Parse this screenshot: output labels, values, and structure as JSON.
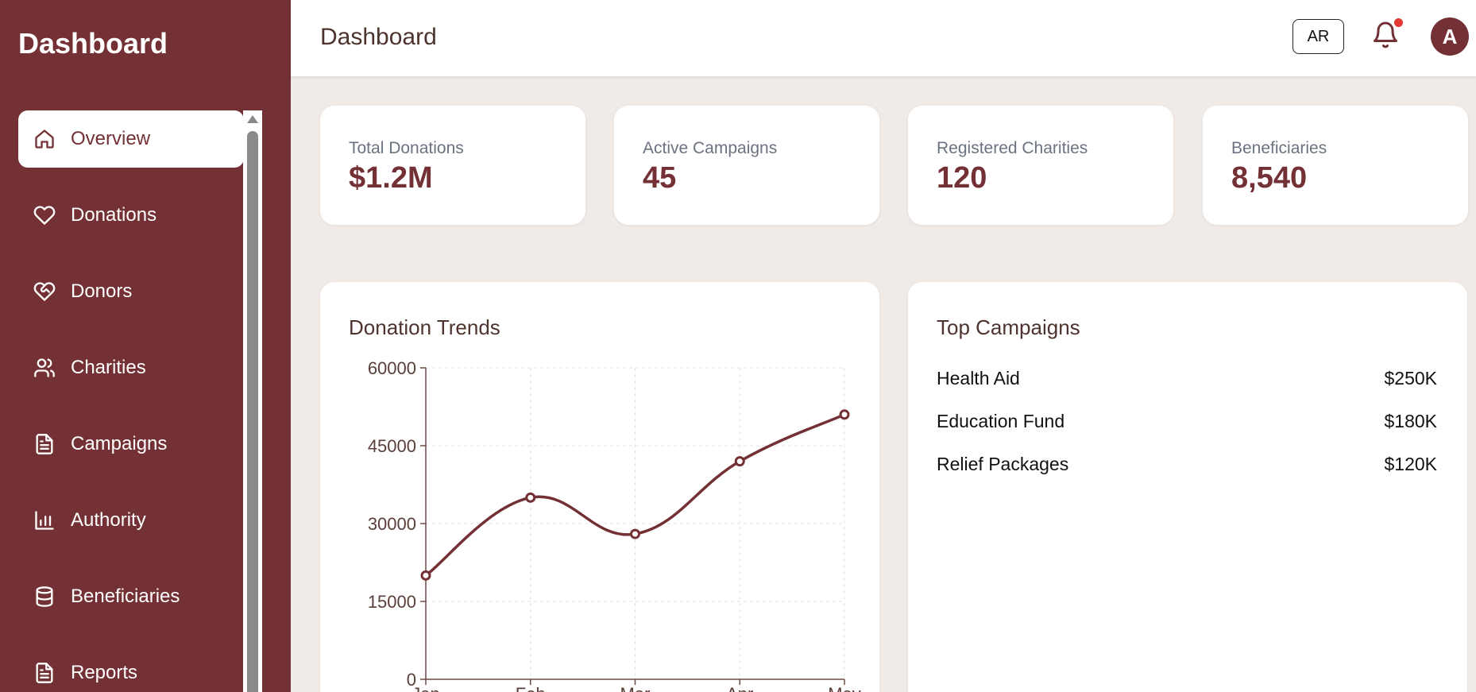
{
  "sidebar": {
    "brand": "Dashboard",
    "items": [
      {
        "label": "Overview",
        "icon": "home-icon",
        "active": true
      },
      {
        "label": "Donations",
        "icon": "heart-icon",
        "active": false
      },
      {
        "label": "Donors",
        "icon": "handshake-heart-icon",
        "active": false
      },
      {
        "label": "Charities",
        "icon": "users-icon",
        "active": false
      },
      {
        "label": "Campaigns",
        "icon": "file-text-icon",
        "active": false
      },
      {
        "label": "Authority",
        "icon": "bar-chart-icon",
        "active": false
      },
      {
        "label": "Beneficiaries",
        "icon": "database-icon",
        "active": false
      },
      {
        "label": "Reports",
        "icon": "file-text-icon",
        "active": false
      }
    ]
  },
  "header": {
    "title": "Dashboard",
    "lang_button": "AR",
    "avatar_initial": "A"
  },
  "stats": [
    {
      "label": "Total Donations",
      "value": "$1.2M"
    },
    {
      "label": "Active Campaigns",
      "value": "45"
    },
    {
      "label": "Registered Charities",
      "value": "120"
    },
    {
      "label": "Beneficiaries",
      "value": "8,540"
    }
  ],
  "trends": {
    "title": "Donation Trends"
  },
  "top_campaigns": {
    "title": "Top Campaigns",
    "rows": [
      {
        "name": "Health Aid",
        "amount": "$250K"
      },
      {
        "name": "Education Fund",
        "amount": "$180K"
      },
      {
        "name": "Relief Packages",
        "amount": "$120K"
      }
    ]
  },
  "colors": {
    "primary": "#733035",
    "background": "#f1ebe8",
    "notification": "#e53935"
  },
  "chart_data": {
    "type": "line",
    "title": "Donation Trends",
    "x": [
      "Jan",
      "Feb",
      "Mar",
      "Apr",
      "May"
    ],
    "values": [
      20000,
      35000,
      28000,
      42000,
      51000
    ],
    "yticks": [
      0,
      15000,
      30000,
      45000,
      60000
    ],
    "ylim": [
      0,
      60000
    ],
    "grid": true,
    "smooth": true
  }
}
